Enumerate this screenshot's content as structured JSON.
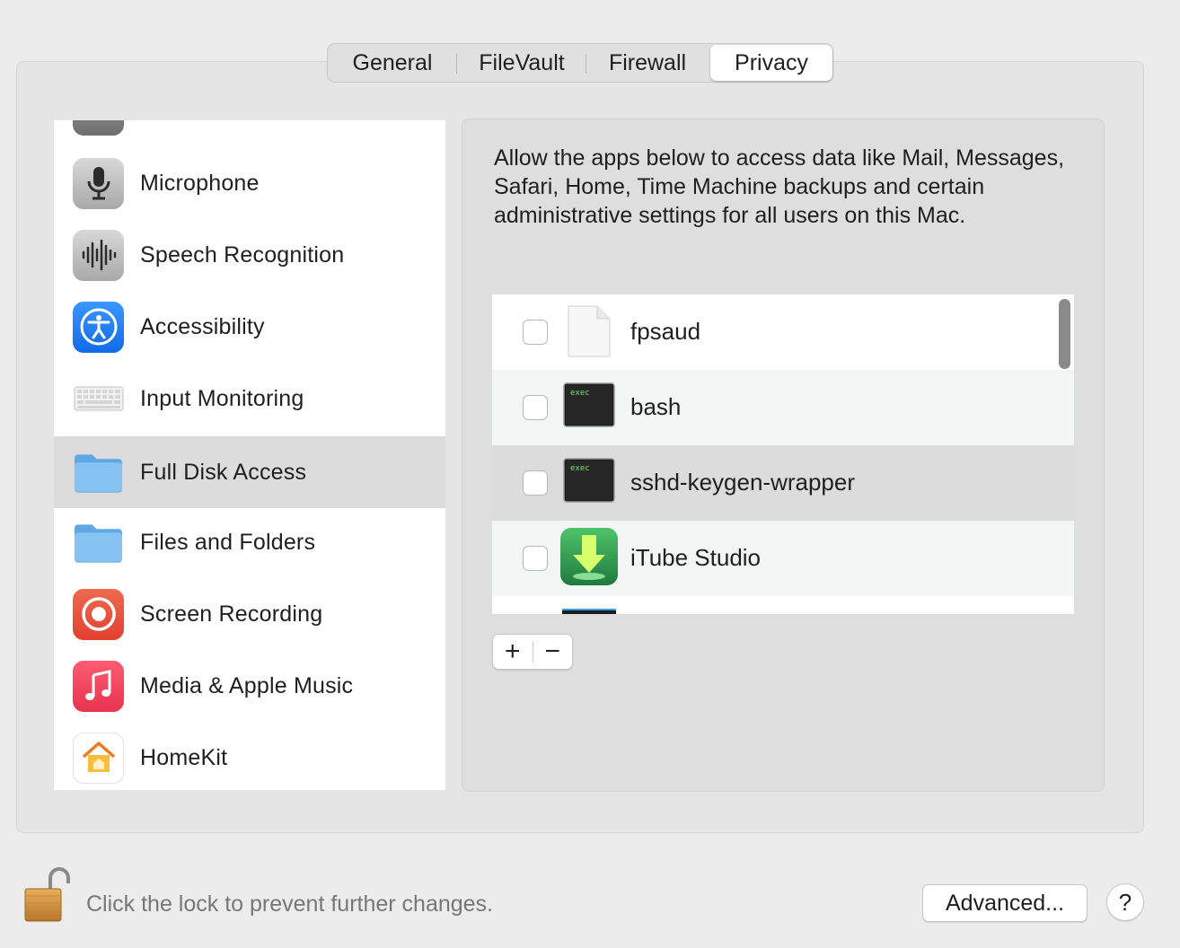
{
  "tabs": [
    {
      "label": "General",
      "active": false
    },
    {
      "label": "FileVault",
      "active": false
    },
    {
      "label": "Firewall",
      "active": false
    },
    {
      "label": "Privacy",
      "active": true
    }
  ],
  "sidebar": {
    "items": [
      {
        "label": "Microphone",
        "icon": "microphone-icon"
      },
      {
        "label": "Speech Recognition",
        "icon": "waveform-icon"
      },
      {
        "label": "Accessibility",
        "icon": "accessibility-icon"
      },
      {
        "label": "Input Monitoring",
        "icon": "keyboard-icon"
      },
      {
        "label": "Full Disk Access",
        "icon": "folder-icon",
        "selected": true
      },
      {
        "label": "Files and Folders",
        "icon": "folder-icon"
      },
      {
        "label": "Screen Recording",
        "icon": "screen-recording-icon"
      },
      {
        "label": "Media & Apple Music",
        "icon": "music-note-icon"
      },
      {
        "label": "HomeKit",
        "icon": "home-icon"
      }
    ]
  },
  "main": {
    "description": "Allow the apps below to access data like Mail, Messages, Safari, Home, Time Machine backups and certain administrative settings for all users on this Mac.",
    "apps": [
      {
        "name": "fpsaud",
        "checked": false,
        "icon": "document-icon"
      },
      {
        "name": "bash",
        "checked": false,
        "icon": "terminal-exec-icon",
        "icon_text": "exec"
      },
      {
        "name": "sshd-keygen-wrapper",
        "checked": false,
        "icon": "terminal-exec-icon",
        "icon_text": "exec",
        "selected": true
      },
      {
        "name": "iTube Studio",
        "checked": false,
        "icon": "download-arrow-icon"
      }
    ],
    "add_symbol": "+",
    "remove_symbol": "−"
  },
  "footer": {
    "lock_text": "Click the lock to prevent further changes.",
    "advanced_label": "Advanced...",
    "help_label": "?"
  },
  "colors": {
    "accessibility_blue": "#1b7ff5",
    "screen_recording_red": "#e9513d",
    "music_red": "#f0445d",
    "folder_blue": "#74b8ee",
    "exec_green": "#7ee27a"
  }
}
